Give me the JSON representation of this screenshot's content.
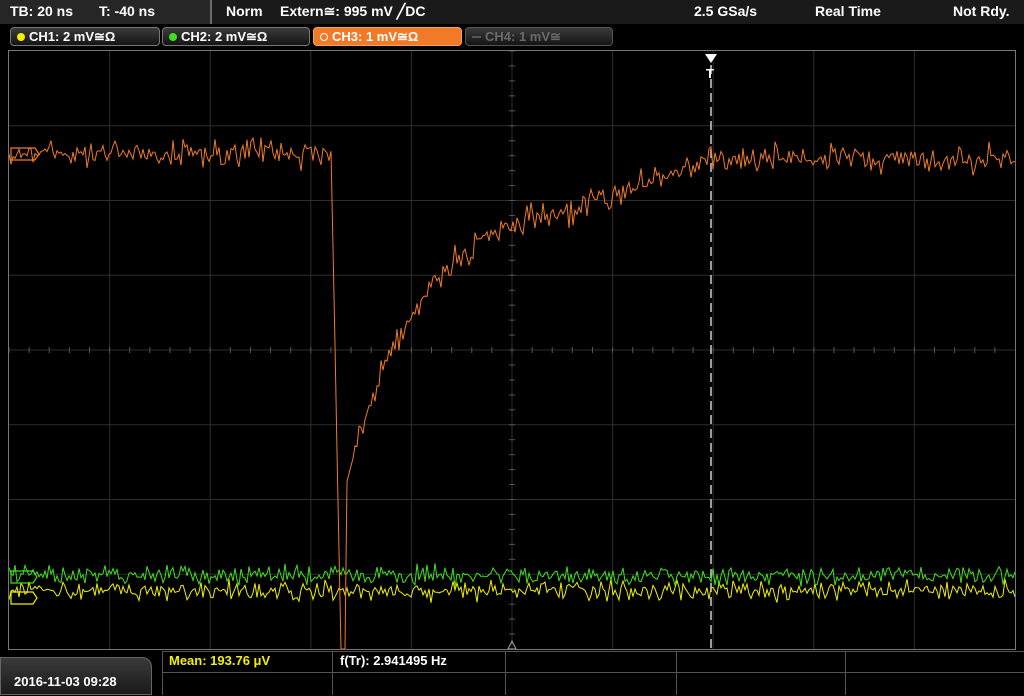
{
  "header": {
    "timebase": "TB: 20 ns",
    "trigger_time": "T: -40 ns",
    "mode": "Norm",
    "trigger_source": "Extern≅: 995 mV ╱DC",
    "sample_rate": "2.5 GSa/s",
    "acquisition": "Real Time",
    "status": "Not Rdy."
  },
  "channels": [
    {
      "label": "CH1: 2 mV≅Ω",
      "color": "#f0f000",
      "state": "on"
    },
    {
      "label": "CH2: 2 mV≅Ω",
      "color": "#40e020",
      "state": "on"
    },
    {
      "label": "CH3: 1 mV≅Ω",
      "color": "#f07a28",
      "state": "active"
    },
    {
      "label": "CH4: 1 mV≅",
      "color": "#6a6a6a",
      "state": "off"
    }
  ],
  "footer": {
    "datetime": "2016-11-03 09:28",
    "mean": "Mean: 193.76 μV",
    "frequency": "f(Tr): 2.941495 Hz"
  },
  "colors": {
    "ch1": "#f0f000",
    "ch2": "#40e020",
    "ch3": "#f07a28",
    "grid": "#3a3a3a",
    "panel": "#262626"
  },
  "icons": {
    "trigger_marker": "trigger-T-icon",
    "ground_marker": "ground-arrow-icon"
  }
}
